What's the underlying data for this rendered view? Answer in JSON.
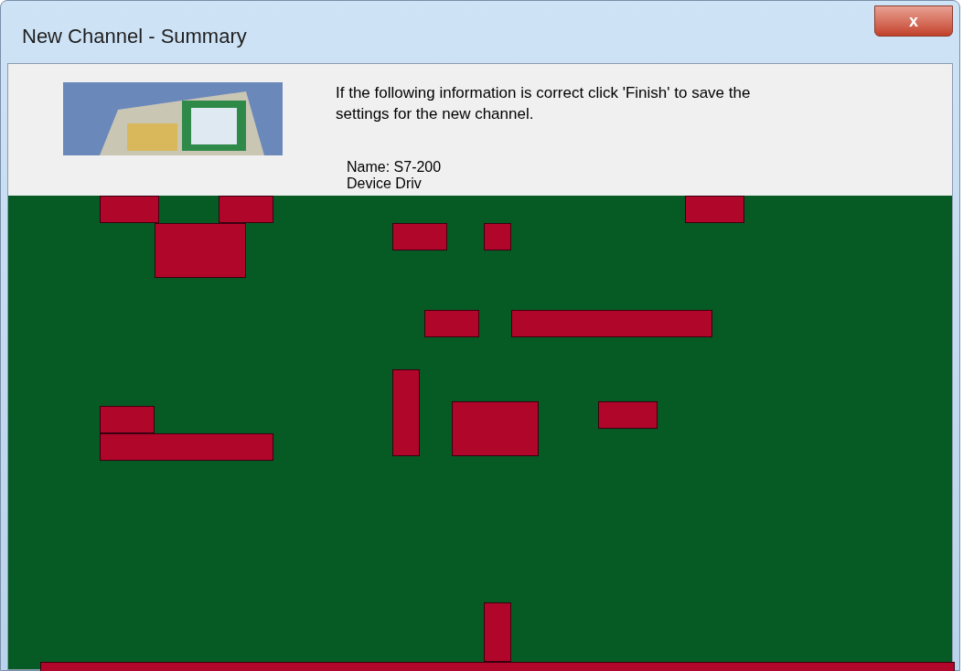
{
  "window": {
    "title": "New Channel - Summary",
    "close": "x"
  },
  "intro": "If the following information is correct click 'Finish' to save the settings for the new channel.",
  "summary": [
    "Name: S7-200",
    "Device Driv"
  ]
}
